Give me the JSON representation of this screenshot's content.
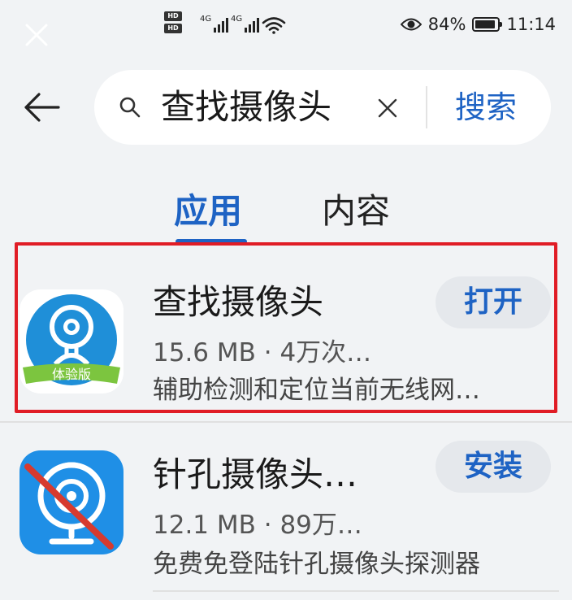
{
  "status_bar": {
    "sim1": "HD",
    "sim2": "HD",
    "net1": "4G",
    "net2": "4G",
    "battery": "84%",
    "time": "11:14"
  },
  "search": {
    "query": "查找摄像头",
    "button_label": "搜索"
  },
  "tabs": [
    {
      "label": "应用",
      "active": true
    },
    {
      "label": "内容",
      "active": false
    }
  ],
  "results": [
    {
      "name": "查找摄像头",
      "meta": "15.6 MB · 4万次…",
      "description": "辅助检测和定位当前无线网…",
      "action": "打开",
      "badge": "体验版",
      "icon": "webcam-icon",
      "highlighted": true
    },
    {
      "name": "针孔摄像头…",
      "meta": "12.1 MB · 89万…",
      "description": "免费免登陆针孔摄像头探测器",
      "action": "安装",
      "icon": "webcam-crossed-icon",
      "highlighted": false
    }
  ],
  "colors": {
    "accent": "#1e63c4",
    "highlight_border": "#e01c25",
    "background": "#f1f3f5"
  }
}
